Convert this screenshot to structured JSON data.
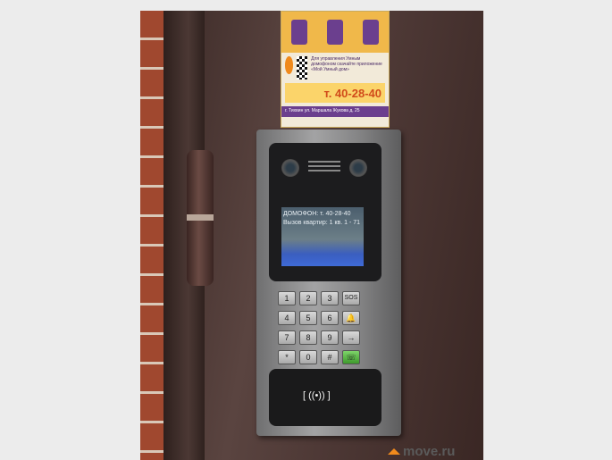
{
  "sticker": {
    "line1": "Для управления Умным домофоном скачайте приложение «Мой Умный дом»",
    "phone": "т. 40-28-40",
    "footer": "г. Тихвин ул. Маршала Жукова д. 25"
  },
  "screen": {
    "line1": "ДОМОФОН: т. 40-28-40",
    "line2": "Вызов квартир: 1 кв. 1 - 71"
  },
  "keys": [
    "1",
    "2",
    "3",
    "SOS",
    "4",
    "5",
    "6",
    "7",
    "8",
    "9",
    "*",
    "0",
    "#"
  ],
  "reader_symbol": "[ ((•)) ]",
  "watermark": "move.ru"
}
